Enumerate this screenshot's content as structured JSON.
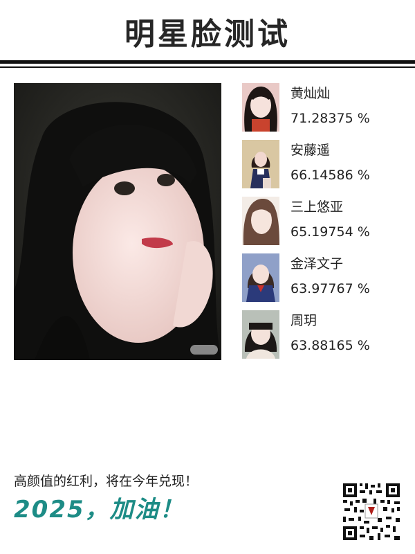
{
  "header": {
    "title": "明星脸测试"
  },
  "results": [
    {
      "name": "黄灿灿",
      "score": "71.28375 %"
    },
    {
      "name": "安藤遥",
      "score": "66.14586 %"
    },
    {
      "name": "三上悠亚",
      "score": "65.19754 %"
    },
    {
      "name": "金泽文子",
      "score": "63.97767 %"
    },
    {
      "name": "周玥",
      "score": "63.88165 %"
    }
  ],
  "footer": {
    "tagline": "高颜值的红利，将在今年兑现！",
    "slogan": "2025，加油！"
  },
  "colors": {
    "accent": "#1d8c86",
    "title": "#262626"
  },
  "icons": {
    "qr": "qr-code-icon"
  }
}
